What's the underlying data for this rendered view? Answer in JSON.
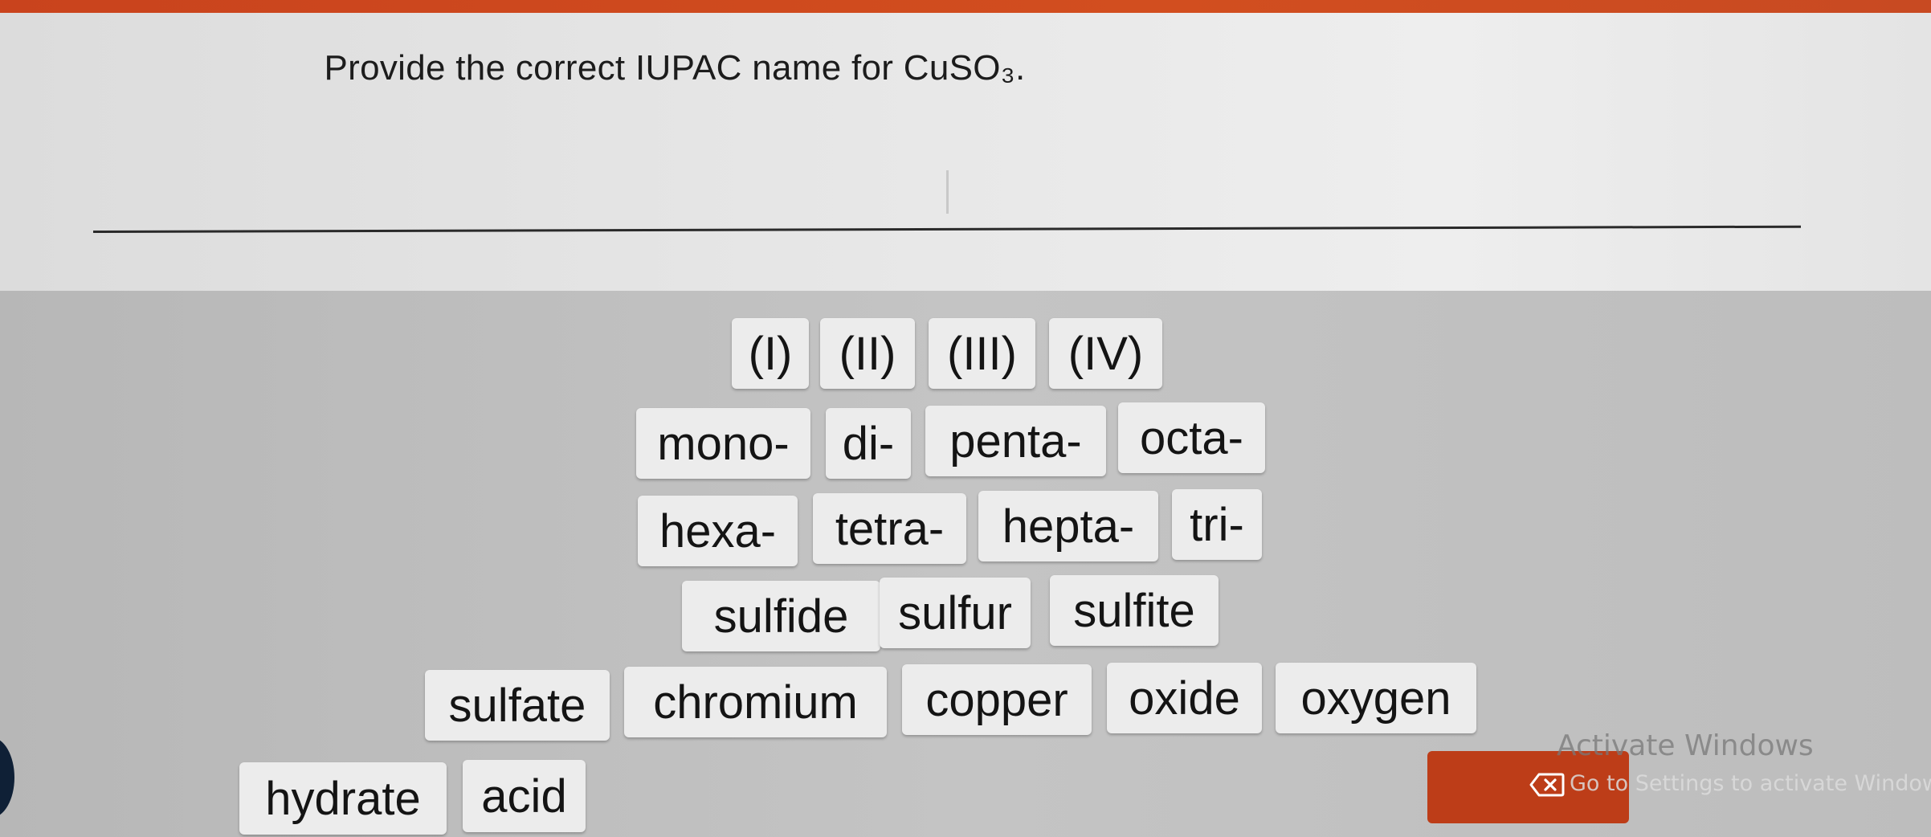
{
  "question": {
    "prompt_text": "Provide the correct IUPAC name for CuSO₃."
  },
  "tiles": {
    "roman": [
      "(I)",
      "(II)",
      "(III)",
      "(IV)"
    ],
    "prefixes_row1": [
      "mono-",
      "di-",
      "penta-",
      "octa-"
    ],
    "prefixes_row2": [
      "hexa-",
      "tetra-",
      "hepta-",
      "tri-"
    ],
    "sulfur_words": [
      "sulfide",
      "sulfur",
      "sulfite"
    ],
    "words_row": [
      "sulfate",
      "chromium",
      "copper",
      "oxide",
      "oxygen"
    ],
    "last_row": [
      "hydrate",
      "acid"
    ]
  },
  "buttons": {
    "clear_icon": "backspace-x-icon"
  },
  "watermark": {
    "title": "Activate Windows",
    "subtitle": "Go to Settings to activate Windows"
  },
  "colors": {
    "accent": "#bd3d18",
    "top_bar": "#d24e1f",
    "tile_bg": "#ececec"
  }
}
